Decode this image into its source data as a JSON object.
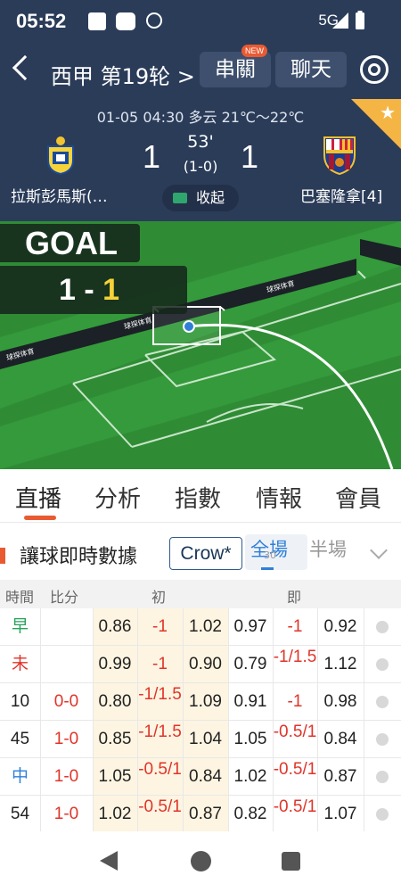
{
  "status_bar": {
    "time": "05:52",
    "network": "5G"
  },
  "nav": {
    "league": "西甲 第19轮 >",
    "parlay": "串關",
    "new_badge": "NEW",
    "chat": "聊天"
  },
  "match": {
    "datetime_weather": "01-05 04:30   多云 21℃～22℃",
    "home_team": "拉斯彭馬斯(…",
    "away_team": "巴塞隆拿[4]",
    "home_score": "1",
    "away_score": "1",
    "minute": "53'",
    "half_score": "(1-0)",
    "collapse": "收起"
  },
  "field": {
    "goal_label": "GOAL",
    "score_home": "1",
    "score_sep": " - ",
    "score_away": "1",
    "ad_text": "球探体育"
  },
  "tabs": [
    "直播",
    "分析",
    "指數",
    "情報",
    "會員"
  ],
  "odds_section": {
    "title": "讓球即時數據",
    "bookmaker": "Crow*",
    "seg_full": "全場",
    "seg_sub": "30",
    "seg_half": "半場"
  },
  "table": {
    "headers": {
      "time": "時間",
      "score": "比分",
      "initial": "初",
      "live": "即"
    },
    "rows": [
      {
        "time": "早",
        "score": "",
        "h1": "0.86",
        "hc1": "-1",
        "a1": "1.02",
        "h2": "0.97",
        "hc2": "-1",
        "a2": "0.92"
      },
      {
        "time": "未",
        "score": "",
        "h1": "0.99",
        "hc1": "-1",
        "a1": "0.90",
        "h2": "0.79",
        "hc2": "-1/1.5",
        "a2": "1.12"
      },
      {
        "time": "10",
        "score": "0-0",
        "h1": "0.80",
        "hc1": "-1/1.5",
        "a1": "1.09",
        "h2": "0.91",
        "hc2": "-1",
        "a2": "0.98"
      },
      {
        "time": "45",
        "score": "1-0",
        "h1": "0.85",
        "hc1": "-1/1.5",
        "a1": "1.04",
        "h2": "1.05",
        "hc2": "-0.5/1",
        "a2": "0.84"
      },
      {
        "time": "中",
        "score": "1-0",
        "h1": "1.05",
        "hc1": "-0.5/1",
        "a1": "0.84",
        "h2": "1.02",
        "hc2": "-0.5/1",
        "a2": "0.87"
      },
      {
        "time": "54",
        "score": "1-0",
        "h1": "1.02",
        "hc1": "-0.5/1",
        "a1": "0.87",
        "h2": "0.82",
        "hc2": "-0.5/1",
        "a2": "1.07"
      }
    ]
  },
  "colors": {
    "header_bg": "#2b3c59",
    "accent": "#e95a32",
    "pitch": "#2f8c35",
    "odds_shade": "#fdf5e2",
    "highlight_score": "#f6d238"
  }
}
